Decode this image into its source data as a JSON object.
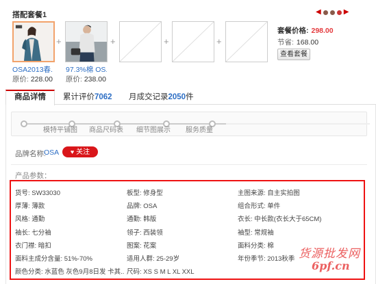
{
  "combo": {
    "title": "搭配套餐1",
    "products": [
      {
        "name": "OSA2013春...",
        "price_label": "原价:",
        "price": "228.00"
      },
      {
        "name": "97.3%棉 OS...",
        "price_label": "原价:",
        "price": "238.00"
      }
    ],
    "plus": "+",
    "combo_price_label": "套餐价格:",
    "combo_price": "298.00",
    "save_label": "节省:",
    "save_value": "168.00",
    "view_button": "查看套餐",
    "pager": {
      "prev": "◀",
      "next": "▶"
    }
  },
  "tabs": {
    "details": "商品详情",
    "reviews_label": "累计评价",
    "reviews_count": "7062",
    "sales_label": "月成交记录",
    "sales_count": "2050",
    "sales_unit": "件"
  },
  "steps": [
    "模特平铺图",
    "商品尺码表",
    "细节图展示",
    "服务质量"
  ],
  "brand": {
    "label": "品牌名称:",
    "name": "OSA",
    "follow": "关注"
  },
  "params_title": "产品参数：",
  "params": [
    [
      "货号: SW33030",
      "板型: 修身型",
      "主图来源: 自主实拍图"
    ],
    [
      "厚薄: 薄款",
      "品牌: OSA",
      "组合形式: 单件"
    ],
    [
      "风格: 通勤",
      "通勤: 韩版",
      "衣长: 中长款(衣长大于65CM)"
    ],
    [
      "袖长: 七分袖",
      "领子: 西装领",
      "袖型: 常规袖"
    ],
    [
      "衣门襟: 暗扣",
      "图案: 花案",
      "面料分类: 棉"
    ],
    [
      "面料主成分含量: 51%-70%",
      "适用人群: 25-29岁",
      "年份季节: 2013秋季"
    ],
    [
      "颜色分类: 水蓝色 灰色9月8日发 卡其...",
      "尺码: XS S M L XL XXL",
      ""
    ]
  ],
  "watermark": {
    "line1": "货源批发网",
    "line2": "6pf.cn"
  }
}
